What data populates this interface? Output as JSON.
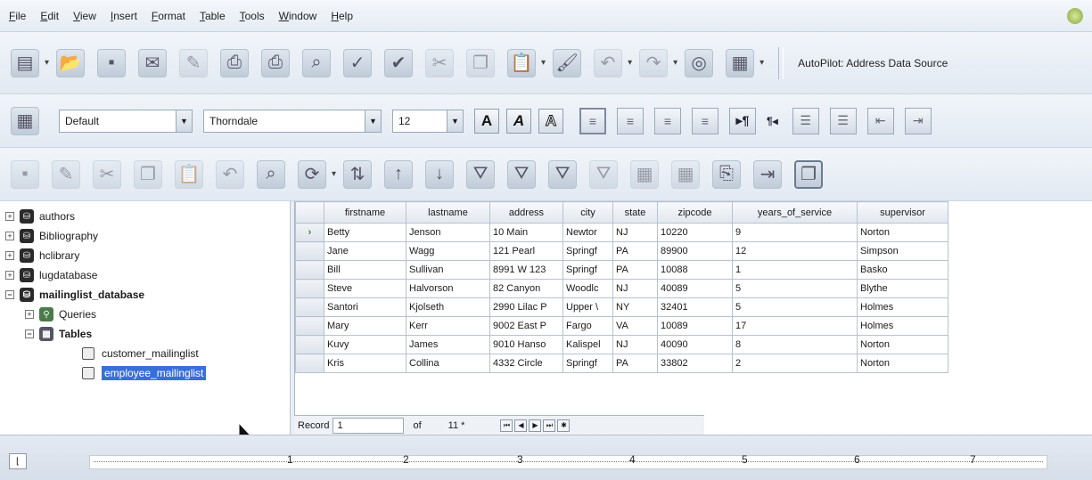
{
  "menu": [
    "File",
    "Edit",
    "View",
    "Insert",
    "Format",
    "Table",
    "Tools",
    "Window",
    "Help"
  ],
  "toolbar1": {
    "icons": [
      "new-icon",
      "open-icon",
      "save-icon",
      "email-icon",
      "edit-file-icon",
      "export-pdf-icon",
      "print-icon",
      "print-preview-icon",
      "spellcheck-icon",
      "autospellcheck-icon",
      "cut-icon",
      "copy-icon",
      "paste-icon",
      "format-paintbrush-icon",
      "undo-icon",
      "redo-icon",
      "navigator-icon",
      "table-icon"
    ],
    "autopilot_label": "AutoPilot: Address Data Source"
  },
  "toolbar2": {
    "style_value": "Default",
    "font_value": "Thorndale",
    "size_value": "12",
    "bold": "A",
    "italic": "A",
    "underline": "A",
    "ltr": "▸¶",
    "rtl": "¶◂"
  },
  "tree": [
    {
      "label": "authors",
      "level": 0,
      "toggle": "+"
    },
    {
      "label": "Bibliography",
      "level": 0,
      "toggle": "+"
    },
    {
      "label": "hclibrary",
      "level": 0,
      "toggle": "+"
    },
    {
      "label": "lugdatabase",
      "level": 0,
      "toggle": "+"
    },
    {
      "label": "mailinglist_database",
      "level": 0,
      "toggle": "−"
    },
    {
      "label": "Queries",
      "level": 1,
      "toggle": "+"
    },
    {
      "label": "Tables",
      "level": 1,
      "toggle": "−"
    },
    {
      "label": "customer_mailinglist",
      "level": 2
    },
    {
      "label": "employee_mailinglist",
      "level": 2
    }
  ],
  "grid": {
    "columns": [
      "firstname",
      "lastname",
      "address",
      "city",
      "state",
      "zipcode",
      "years_of_service",
      "supervisor"
    ],
    "rows": [
      [
        "Betty",
        "Jenson",
        "10 Main",
        "Newtor",
        "NJ",
        "10220",
        "9",
        "Norton"
      ],
      [
        "Jane",
        "Wagg",
        "121 Pearl",
        "Springf",
        "PA",
        "89900",
        "12",
        "Simpson"
      ],
      [
        "Bill",
        "Sullivan",
        "8991 W 123",
        "Springf",
        "PA",
        "10088",
        "1",
        "Basko"
      ],
      [
        "Steve",
        "Halvorson",
        "82 Canyon",
        "Woodlc",
        "NJ",
        "40089",
        "5",
        "Blythe"
      ],
      [
        "Santori",
        "Kjolseth",
        "2990 Lilac P",
        "Upper \\",
        "NY",
        "32401",
        "5",
        "Holmes"
      ],
      [
        "Mary",
        "Kerr",
        "9002 East P",
        "Fargo",
        "VA",
        "10089",
        "17",
        "Holmes"
      ],
      [
        "Kuvy",
        "James",
        "9010 Hanso",
        "Kalispel",
        "NJ",
        "40090",
        "8",
        "Norton"
      ],
      [
        "Kris",
        "Collina",
        "4332 Circle",
        "Springf",
        "PA",
        "33802",
        "2",
        "Norton"
      ]
    ]
  },
  "nav": {
    "record_label": "Record",
    "record_value": "1",
    "of_label": "of",
    "total": "11 *"
  },
  "ruler": {
    "numbers": [
      "1",
      "2",
      "3",
      "4",
      "5",
      "6",
      "7"
    ]
  }
}
